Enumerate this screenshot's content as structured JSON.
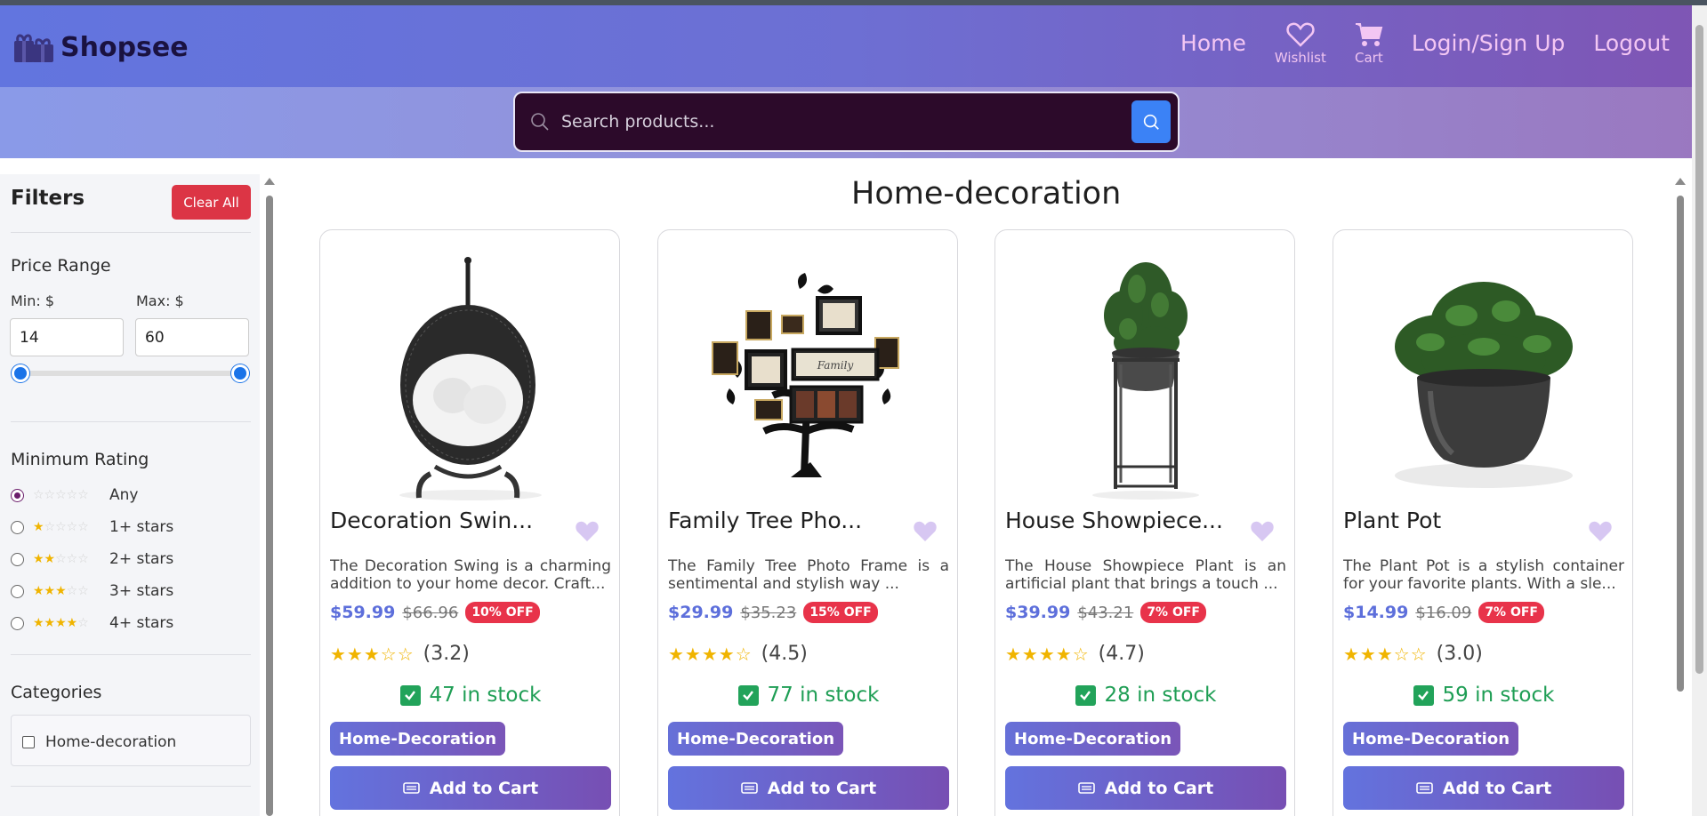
{
  "brand": {
    "name": "Shopsee"
  },
  "nav": {
    "home": "Home",
    "wishlist": "Wishlist",
    "cart": "Cart",
    "login": "Login/Sign Up",
    "logout": "Logout"
  },
  "search": {
    "placeholder": "Search products..."
  },
  "filters": {
    "title": "Filters",
    "clear_label": "Clear All",
    "price_range": {
      "title": "Price Range",
      "min_label": "Min: $",
      "max_label": "Max: $",
      "min_value": "14",
      "max_value": "60"
    },
    "rating": {
      "title": "Minimum Rating",
      "selected": "Any",
      "options": [
        {
          "label": "Any",
          "stars": 0
        },
        {
          "label": "1+ stars",
          "stars": 1
        },
        {
          "label": "2+ stars",
          "stars": 2
        },
        {
          "label": "3+ stars",
          "stars": 3
        },
        {
          "label": "4+ stars",
          "stars": 4
        }
      ]
    },
    "categories": {
      "title": "Categories",
      "items": [
        {
          "label": "Home-decoration",
          "checked": false
        }
      ]
    }
  },
  "main": {
    "title": "Home-decoration",
    "products": [
      {
        "name": "Decoration Swin...",
        "description": "The Decoration Swing is a charming addition to your home decor. Craft...",
        "price": "$59.99",
        "old_price": "$66.96",
        "discount": "10% OFF",
        "stars": "★★★☆☆",
        "rating": "(3.2)",
        "stock": "47 in stock",
        "category": "Home-Decoration",
        "cart_label": "Add to Cart",
        "image_icon": "hanging-swing-chair"
      },
      {
        "name": "Family Tree Pho...",
        "description": "The Family Tree Photo Frame is a sentimental and stylish way ...",
        "price": "$29.99",
        "old_price": "$35.23",
        "discount": "15% OFF",
        "stars": "★★★★☆",
        "rating": "(4.5)",
        "stock": "77 in stock",
        "category": "Home-Decoration",
        "cart_label": "Add to Cart",
        "image_icon": "family-tree-frame"
      },
      {
        "name": "House Showpiece...",
        "description": "The House Showpiece Plant is an artificial plant that brings a touch ...",
        "price": "$39.99",
        "old_price": "$43.21",
        "discount": "7% OFF",
        "stars": "★★★★☆",
        "rating": "(4.7)",
        "stock": "28 in stock",
        "category": "Home-Decoration",
        "cart_label": "Add to Cart",
        "image_icon": "plant-on-stand"
      },
      {
        "name": "Plant Pot",
        "description": "The Plant Pot is a stylish container for your favorite plants. With a sle...",
        "price": "$14.99",
        "old_price": "$16.09",
        "discount": "7% OFF",
        "stars": "★★★☆☆",
        "rating": "(3.0)",
        "stock": "59 in stock",
        "category": "Home-Decoration",
        "cart_label": "Add to Cart",
        "image_icon": "potted-plant"
      }
    ]
  },
  "colors": {
    "header_start": "#6275df",
    "header_end": "#7f55b4",
    "nav_text": "#f3c6f3",
    "price": "#5d6fdb",
    "discount": "#e8334a",
    "stock": "#1f9e55",
    "clear_button": "#dc3545",
    "search_button": "#3b82f6"
  }
}
